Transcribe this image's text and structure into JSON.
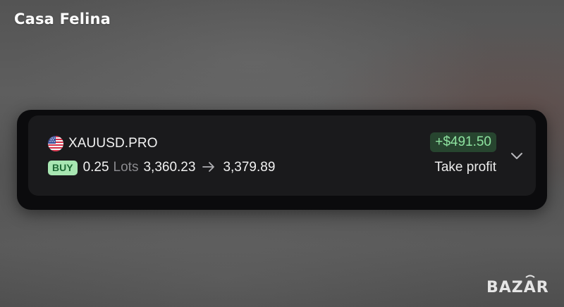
{
  "overlay": {
    "title": "Casa Felina",
    "logo_text": "BAZAR"
  },
  "trade": {
    "symbol": "XAUUSD.PRO",
    "flag_icon": "us-flag-icon",
    "side": "BUY",
    "lots": "0.25",
    "lots_unit": "Lots",
    "open_price": "3,360.23",
    "close_price": "3,379.89",
    "profit": "+$491.50",
    "close_reason": "Take profit",
    "expand_icon": "chevron-down-icon"
  },
  "colors": {
    "card_background": "#1a1a1c",
    "buy_badge_bg": "#a8e6b2",
    "buy_badge_text": "#1f6a36",
    "profit_badge_bg": "#27452f",
    "profit_text": "#8ee3a0"
  }
}
